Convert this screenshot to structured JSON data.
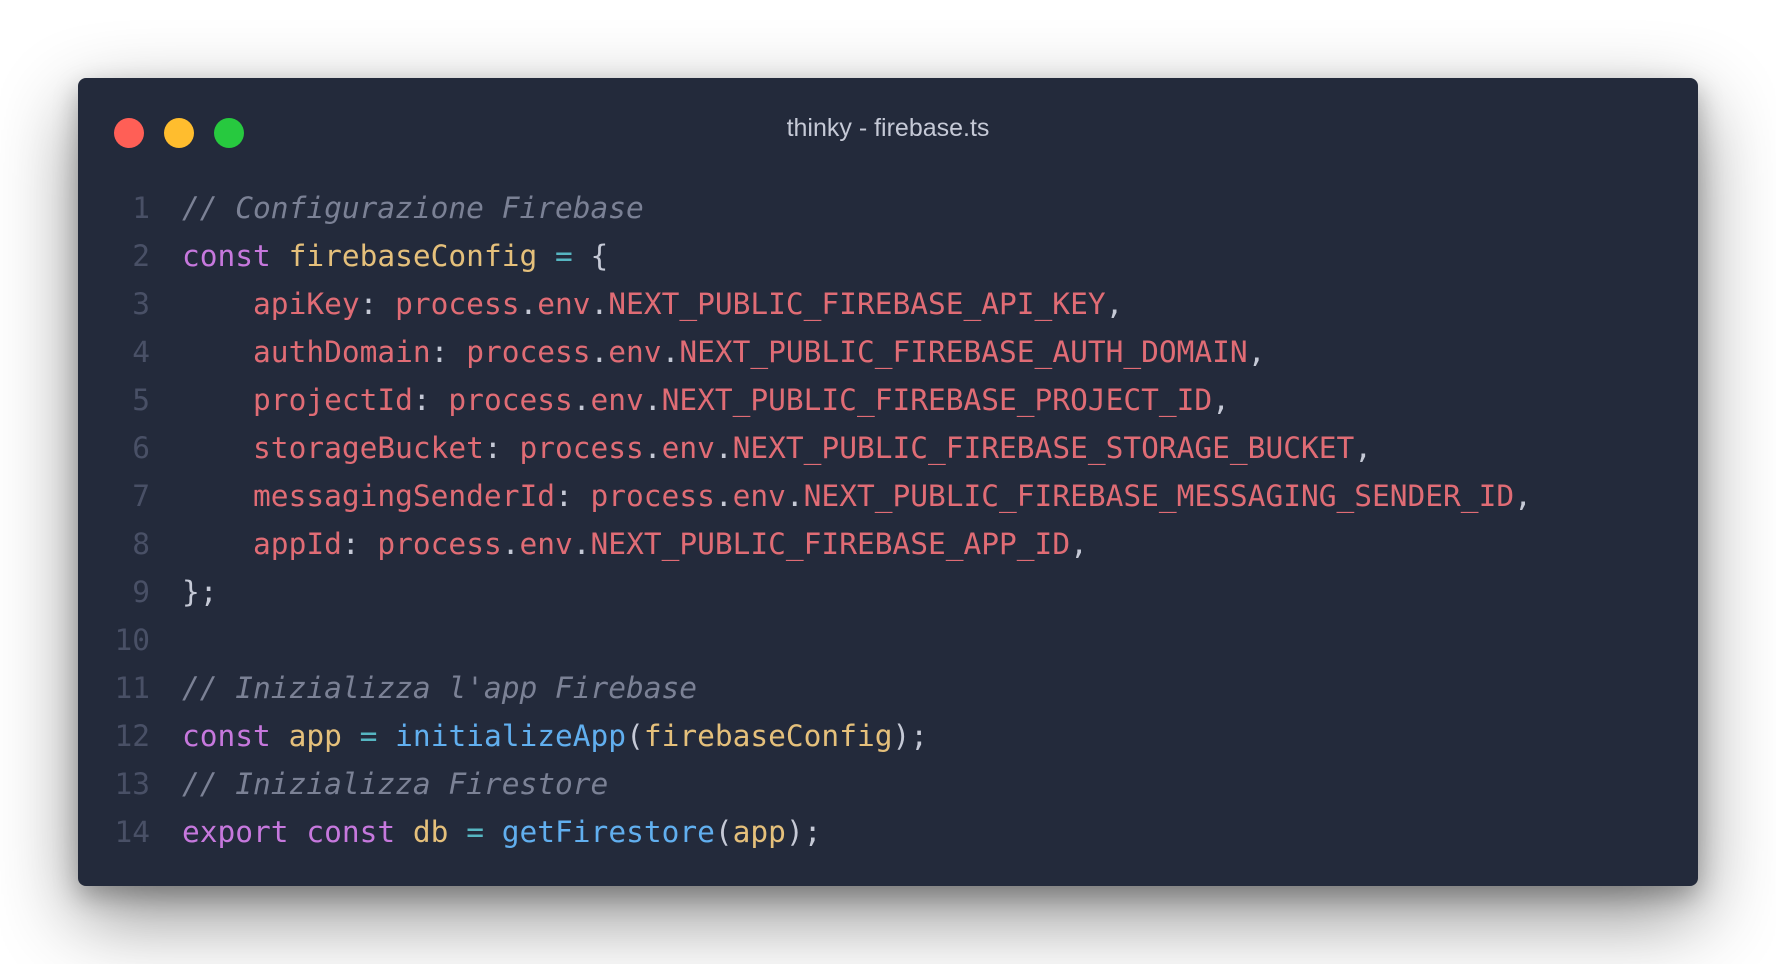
{
  "window": {
    "title": "thinky - firebase.ts",
    "background": "#232a3b"
  },
  "traffic_lights": {
    "close_color": "#ff5f56",
    "minimize_color": "#ffbd2e",
    "zoom_color": "#27c93f"
  },
  "colors": {
    "comment": "#7b8195",
    "keyword": "#c678dd",
    "variable": "#e5c07b",
    "operator": "#56b6c2",
    "function": "#61afef",
    "property": "#e06c75",
    "punctuation": "#c5c9d6",
    "line_number": "#495066"
  },
  "code": {
    "lines": [
      {
        "number": "1",
        "tokens": [
          {
            "t": "// Configurazione Firebase",
            "c": "comment"
          }
        ]
      },
      {
        "number": "2",
        "tokens": [
          {
            "t": "const",
            "c": "keyword"
          },
          {
            "t": " ",
            "c": "punct"
          },
          {
            "t": "firebaseConfig",
            "c": "var"
          },
          {
            "t": " ",
            "c": "punct"
          },
          {
            "t": "=",
            "c": "op"
          },
          {
            "t": " {",
            "c": "punct"
          }
        ]
      },
      {
        "number": "3",
        "tokens": [
          {
            "t": "    apiKey",
            "c": "prop"
          },
          {
            "t": ": ",
            "c": "punct"
          },
          {
            "t": "process",
            "c": "env"
          },
          {
            "t": ".",
            "c": "punct"
          },
          {
            "t": "env",
            "c": "env"
          },
          {
            "t": ".",
            "c": "punct"
          },
          {
            "t": "NEXT_PUBLIC_FIREBASE_API_KEY",
            "c": "env"
          },
          {
            "t": ",",
            "c": "punct"
          }
        ]
      },
      {
        "number": "4",
        "tokens": [
          {
            "t": "    authDomain",
            "c": "prop"
          },
          {
            "t": ": ",
            "c": "punct"
          },
          {
            "t": "process",
            "c": "env"
          },
          {
            "t": ".",
            "c": "punct"
          },
          {
            "t": "env",
            "c": "env"
          },
          {
            "t": ".",
            "c": "punct"
          },
          {
            "t": "NEXT_PUBLIC_FIREBASE_AUTH_DOMAIN",
            "c": "env"
          },
          {
            "t": ",",
            "c": "punct"
          }
        ]
      },
      {
        "number": "5",
        "tokens": [
          {
            "t": "    projectId",
            "c": "prop"
          },
          {
            "t": ": ",
            "c": "punct"
          },
          {
            "t": "process",
            "c": "env"
          },
          {
            "t": ".",
            "c": "punct"
          },
          {
            "t": "env",
            "c": "env"
          },
          {
            "t": ".",
            "c": "punct"
          },
          {
            "t": "NEXT_PUBLIC_FIREBASE_PROJECT_ID",
            "c": "env"
          },
          {
            "t": ",",
            "c": "punct"
          }
        ]
      },
      {
        "number": "6",
        "tokens": [
          {
            "t": "    storageBucket",
            "c": "prop"
          },
          {
            "t": ": ",
            "c": "punct"
          },
          {
            "t": "process",
            "c": "env"
          },
          {
            "t": ".",
            "c": "punct"
          },
          {
            "t": "env",
            "c": "env"
          },
          {
            "t": ".",
            "c": "punct"
          },
          {
            "t": "NEXT_PUBLIC_FIREBASE_STORAGE_BUCKET",
            "c": "env"
          },
          {
            "t": ",",
            "c": "punct"
          }
        ]
      },
      {
        "number": "7",
        "tokens": [
          {
            "t": "    messagingSenderId",
            "c": "prop"
          },
          {
            "t": ": ",
            "c": "punct"
          },
          {
            "t": "process",
            "c": "env"
          },
          {
            "t": ".",
            "c": "punct"
          },
          {
            "t": "env",
            "c": "env"
          },
          {
            "t": ".",
            "c": "punct"
          },
          {
            "t": "NEXT_PUBLIC_FIREBASE_MESSAGING_SENDER_ID",
            "c": "env"
          },
          {
            "t": ",",
            "c": "punct"
          }
        ]
      },
      {
        "number": "8",
        "tokens": [
          {
            "t": "    appId",
            "c": "prop"
          },
          {
            "t": ": ",
            "c": "punct"
          },
          {
            "t": "process",
            "c": "env"
          },
          {
            "t": ".",
            "c": "punct"
          },
          {
            "t": "env",
            "c": "env"
          },
          {
            "t": ".",
            "c": "punct"
          },
          {
            "t": "NEXT_PUBLIC_FIREBASE_APP_ID",
            "c": "env"
          },
          {
            "t": ",",
            "c": "punct"
          }
        ]
      },
      {
        "number": "9",
        "tokens": [
          {
            "t": "};",
            "c": "punct"
          }
        ]
      },
      {
        "number": "10",
        "tokens": []
      },
      {
        "number": "11",
        "tokens": [
          {
            "t": "// Inizializza l'app Firebase",
            "c": "comment"
          }
        ]
      },
      {
        "number": "12",
        "tokens": [
          {
            "t": "const",
            "c": "keyword"
          },
          {
            "t": " ",
            "c": "punct"
          },
          {
            "t": "app",
            "c": "var"
          },
          {
            "t": " ",
            "c": "punct"
          },
          {
            "t": "=",
            "c": "op"
          },
          {
            "t": " ",
            "c": "punct"
          },
          {
            "t": "initializeApp",
            "c": "func"
          },
          {
            "t": "(",
            "c": "punct"
          },
          {
            "t": "firebaseConfig",
            "c": "var"
          },
          {
            "t": ");",
            "c": "punct"
          }
        ]
      },
      {
        "number": "13",
        "tokens": [
          {
            "t": "// Inizializza Firestore",
            "c": "comment"
          }
        ]
      },
      {
        "number": "14",
        "tokens": [
          {
            "t": "export",
            "c": "keyword"
          },
          {
            "t": " ",
            "c": "punct"
          },
          {
            "t": "const",
            "c": "keyword"
          },
          {
            "t": " ",
            "c": "punct"
          },
          {
            "t": "db",
            "c": "var"
          },
          {
            "t": " ",
            "c": "punct"
          },
          {
            "t": "=",
            "c": "op"
          },
          {
            "t": " ",
            "c": "punct"
          },
          {
            "t": "getFirestore",
            "c": "func"
          },
          {
            "t": "(",
            "c": "punct"
          },
          {
            "t": "app",
            "c": "var"
          },
          {
            "t": ");",
            "c": "punct"
          }
        ]
      }
    ]
  }
}
